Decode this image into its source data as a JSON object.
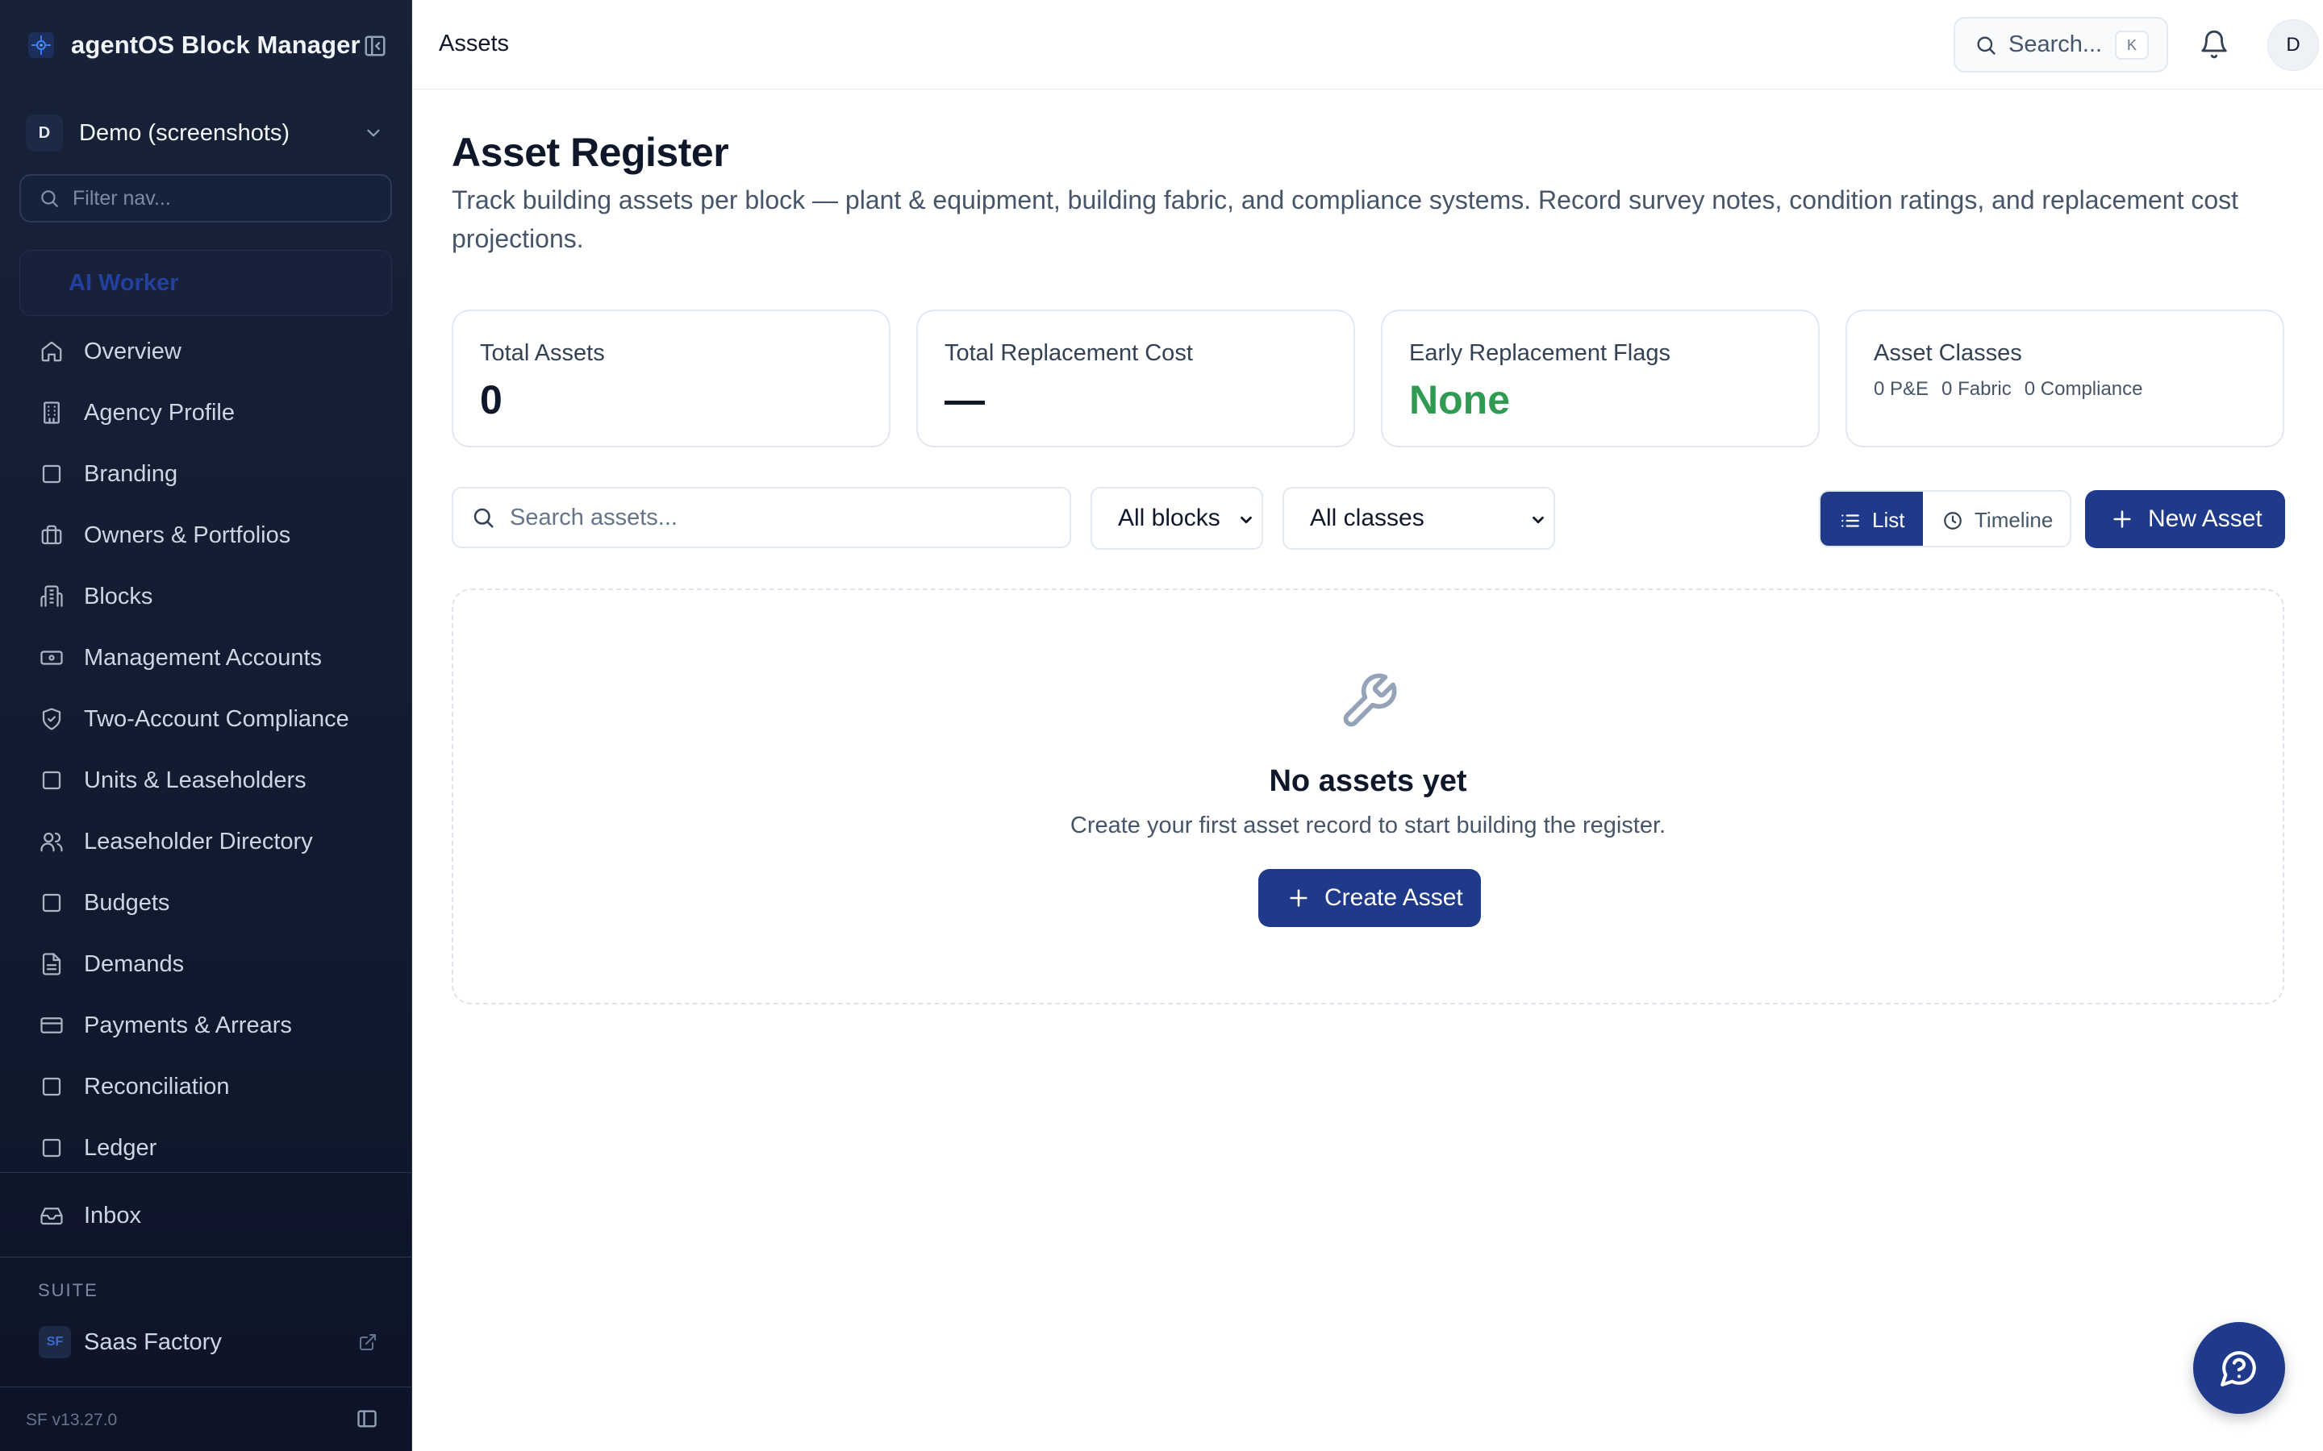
{
  "app": {
    "name": "agentOS Block Manager",
    "workspace_avatar": "D",
    "workspace_name": "Demo (screenshots)",
    "nav_filter_placeholder": "Filter nav...",
    "ai_worker_label": "AI Worker"
  },
  "sidebar": {
    "items": [
      {
        "label": "Overview",
        "icon": "home-icon"
      },
      {
        "label": "Agency Profile",
        "icon": "building-icon"
      },
      {
        "label": "Branding",
        "icon": "square-icon"
      },
      {
        "label": "Owners & Portfolios",
        "icon": "briefcase-icon"
      },
      {
        "label": "Blocks",
        "icon": "apartment-icon"
      },
      {
        "label": "Management Accounts",
        "icon": "banknote-icon"
      },
      {
        "label": "Two-Account Compliance",
        "icon": "shield-check-icon"
      },
      {
        "label": "Units & Leaseholders",
        "icon": "square-icon"
      },
      {
        "label": "Leaseholder Directory",
        "icon": "users-icon"
      },
      {
        "label": "Budgets",
        "icon": "square-icon"
      },
      {
        "label": "Demands",
        "icon": "file-text-icon"
      },
      {
        "label": "Payments & Arrears",
        "icon": "credit-card-icon"
      },
      {
        "label": "Reconciliation",
        "icon": "square-icon"
      },
      {
        "label": "Ledger",
        "icon": "square-icon"
      }
    ],
    "inbox_label": "Inbox",
    "suite_heading": "SUITE",
    "suite_badge": "SF",
    "suite_item_label": "Saas Factory",
    "version": "SF v13.27.0"
  },
  "topbar": {
    "breadcrumb": "Assets",
    "search_label": "Search...",
    "search_shortcut": "K",
    "user_avatar": "D"
  },
  "page": {
    "title": "Asset Register",
    "description": "Track building assets per block — plant & equipment, building fabric, and compliance systems. Record survey notes, condition ratings, and replacement cost projections."
  },
  "stats": {
    "total_assets_label": "Total Assets",
    "total_assets_value": "0",
    "replacement_cost_label": "Total Replacement Cost",
    "replacement_cost_value": "—",
    "early_flags_label": "Early Replacement Flags",
    "early_flags_value": "None",
    "asset_classes_label": "Asset Classes",
    "class_pe": "0 P&E",
    "class_fabric": "0 Fabric",
    "class_compliance": "0 Compliance"
  },
  "filters": {
    "search_placeholder": "Search assets...",
    "blocks_selected": "All blocks",
    "classes_selected": "All classes"
  },
  "view_toggle": {
    "list_label": "List",
    "timeline_label": "Timeline",
    "active": "List"
  },
  "actions": {
    "new_asset_label": "New Asset",
    "create_asset_label": "Create Asset"
  },
  "empty_state": {
    "title": "No assets yet",
    "description": "Create your first asset record to start building the register."
  },
  "colors": {
    "sidebar_bg": "#172238",
    "primary": "#1f3a8a",
    "success": "#2e9a52"
  }
}
